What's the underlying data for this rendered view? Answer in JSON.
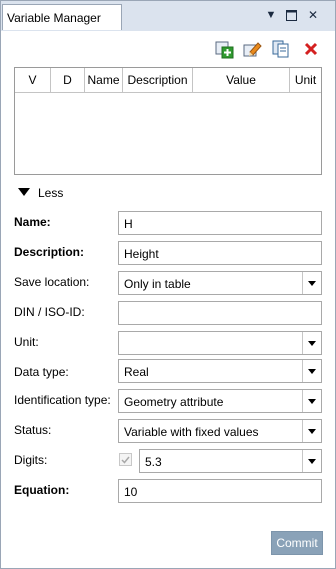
{
  "window": {
    "tab_title": "Variable Manager"
  },
  "toolbar": {
    "icons": [
      "new-variable-icon",
      "edit-variable-icon",
      "copy-variable-icon",
      "delete-variable-icon"
    ]
  },
  "table": {
    "columns": [
      "V",
      "D",
      "Name",
      "Description",
      "Value",
      "Unit"
    ],
    "rows": []
  },
  "details_toggle": {
    "label": "Less"
  },
  "form": {
    "name": {
      "label": "Name:",
      "value": "H"
    },
    "description": {
      "label": "Description:",
      "value": "Height"
    },
    "save_location": {
      "label": "Save location:",
      "value": "Only in table"
    },
    "din_iso_id": {
      "label": "DIN / ISO-ID:",
      "value": ""
    },
    "unit": {
      "label": "Unit:",
      "value": ""
    },
    "data_type": {
      "label": "Data type:",
      "value": "Real"
    },
    "identification_type": {
      "label": "Identification type:",
      "value": "Geometry attribute"
    },
    "status": {
      "label": "Status:",
      "value": "Variable with fixed values"
    },
    "digits": {
      "label": "Digits:",
      "value": "5.3",
      "checked": true
    },
    "equation": {
      "label": "Equation:",
      "value": "10"
    }
  },
  "commit": {
    "label": "Commit"
  },
  "colors": {
    "accent": "#8aa2b8",
    "tabstrip": "#dbe3ee",
    "delete_red": "#d42020",
    "add_green": "#2f9a2f"
  }
}
